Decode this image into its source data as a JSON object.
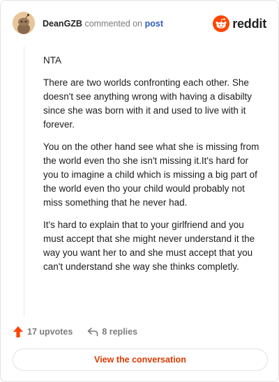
{
  "header": {
    "username": "DeanGZB",
    "action_text": "commented on",
    "target_link": "post",
    "brand_name": "reddit",
    "brand_color": "#ff4500",
    "avatar_color": "#e8c69a"
  },
  "comment": {
    "paragraphs": [
      "NTA",
      "There are two worlds confronting each other. She doesn't see anything wrong with having a disabilty since she was born with it and used to live with it forever.",
      "You on the other hand see what she is missing from the world even tho she isn't missing it.It's hard for you to imagine a child which is missing a big part of the world even tho your child would probably not miss something that he never had.",
      "It's hard to explain that to your girlfriend and you must accept that she might never understand it the way you want her to and she must accept that you can't understand she way she thinks completly."
    ]
  },
  "footer": {
    "upvotes_label": "17 upvotes",
    "upvote_icon": "upvote-arrow-icon",
    "upvote_color": "#ff4500",
    "replies_label": "8 replies",
    "reply_icon": "reply-arrow-icon",
    "cta_label": "View the conversation",
    "cta_color": "#d93a00"
  }
}
